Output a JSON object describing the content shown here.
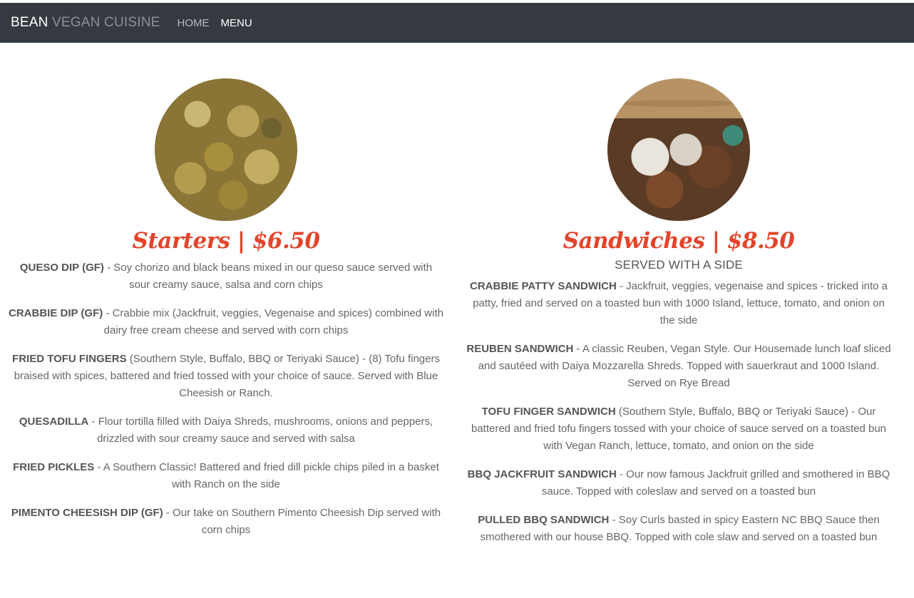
{
  "navbar": {
    "brand_part1": "BEAN",
    "brand_part2": "VEGAN CUISINE",
    "links": [
      {
        "label": "HOME",
        "active": false
      },
      {
        "label": "MENU",
        "active": true
      }
    ]
  },
  "starters": {
    "title": "Starters | $6.50",
    "photo": "fried-pickles-photo",
    "items": [
      {
        "name": "QUESO DIP (GF)",
        "desc": " - Soy chorizo and black beans mixed in our queso sauce served with sour creamy sauce, salsa and corn chips"
      },
      {
        "name": "CRABBIE DIP (GF)",
        "desc": " - Crabbie mix (Jackfruit, veggies, Vegenaise and spices) combined with dairy free cream cheese and served with corn chips"
      },
      {
        "name": "FRIED TOFU FINGERS",
        "desc": " (Southern Style, Buffalo, BBQ or Teriyaki Sauce) - (8) Tofu fingers braised with spices, battered and fried tossed with your choice of sauce. Served with Blue Cheesish or Ranch."
      },
      {
        "name": "QUESADILLA",
        "desc": " - Flour tortilla filled with Daiya Shreds, mushrooms, onions and peppers, drizzled with sour creamy sauce and served with salsa"
      },
      {
        "name": "FRIED PICKLES",
        "desc": " - A Southern Classic! Battered and fried dill pickle chips piled in a basket with Ranch on the side"
      },
      {
        "name": "PIMENTO CHEESISH DIP (GF)",
        "desc": " - Our take on Southern Pimento Cheesish Dip served with corn chips"
      }
    ]
  },
  "sandwiches": {
    "title": "Sandwiches | $8.50",
    "subtitle": "SERVED WITH A SIDE",
    "photo": "sandwich-photo",
    "items": [
      {
        "name": "CRABBIE PATTY SANDWICH",
        "desc": " - Jackfruit, veggies, vegenaise and spices - tricked into a patty, fried and served on a toasted bun with 1000 Island, lettuce, tomato, and onion on the side"
      },
      {
        "name": "REUBEN SANDWICH",
        "desc": " - A classic Reuben, Vegan Style. Our Housemade lunch loaf sliced and sautéed with Daiya Mozzarella Shreds. Topped with sauerkraut and 1000 Island. Served on Rye Bread"
      },
      {
        "name": "TOFU FINGER SANDWICH",
        "desc": " (Southern Style, Buffalo, BBQ or Teriyaki Sauce) - Our battered and fried tofu fingers tossed with your choice of sauce served on a toasted bun with Vegan Ranch, lettuce, tomato, and onion on the side"
      },
      {
        "name": "BBQ JACKFRUIT SANDWICH",
        "desc": " - Our now famous Jackfruit grilled and smothered in BBQ sauce. Topped with coleslaw and served on a toasted bun"
      },
      {
        "name": "PULLED BBQ SANDWICH",
        "desc": " - Soy Curls basted in spicy Eastern NC BBQ Sauce then smothered with our house BBQ. Topped with cole slaw and served on a toasted bun"
      }
    ]
  },
  "colors": {
    "navbar_bg": "#343a40",
    "accent": "#e2452b"
  }
}
